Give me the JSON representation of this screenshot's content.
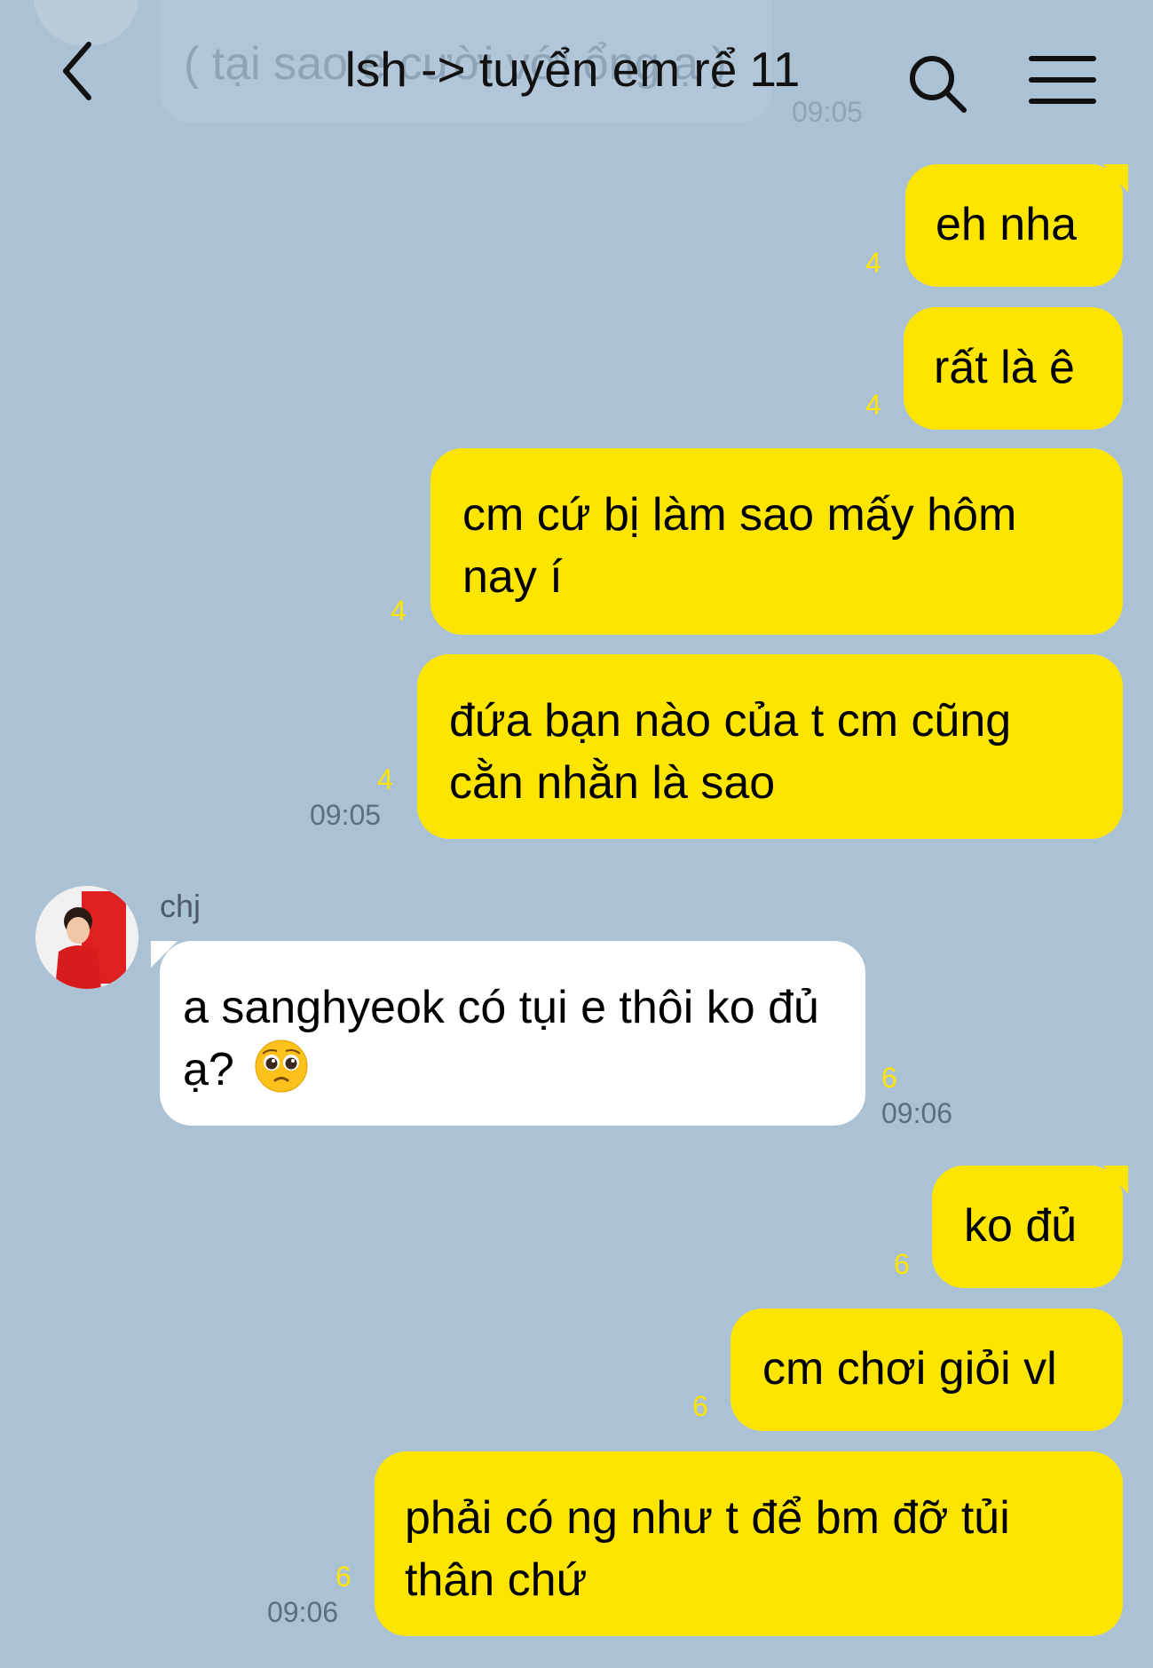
{
  "header": {
    "title": "lsh -> tuyển em rể",
    "member_count": "11"
  },
  "background_message": {
    "text": "( tại sao e cười với ổng ạ )",
    "time": "09:05"
  },
  "messages": [
    {
      "text": "eh nha",
      "unread": "4"
    },
    {
      "text": "rất là ê",
      "unread": "4"
    },
    {
      "text": "cm cứ bị làm sao mấy hôm nay í",
      "unread": "4"
    },
    {
      "text": "đứa bạn nào của t cm cũng cằn nhằn là sao",
      "unread": "4",
      "time": "09:05"
    },
    {
      "sender": "chj",
      "text": "a sanghyeok có tụi e thôi ko đủ ạ?",
      "unread": "6",
      "time": "09:06"
    },
    {
      "text": "ko đủ",
      "unread": "6"
    },
    {
      "text": "cm chơi giỏi vl",
      "unread": "6"
    },
    {
      "text": "phải có ng như t để bm đỡ tủi thân chứ",
      "unread": "6",
      "time": "09:06"
    }
  ],
  "colors": {
    "background": "#abc1d4",
    "outgoing_bubble": "#fee500",
    "incoming_bubble": "#ffffff",
    "unread_count": "#fee500"
  },
  "icons": [
    "back-icon",
    "search-icon",
    "menu-icon",
    "pleading-face-emoji"
  ]
}
